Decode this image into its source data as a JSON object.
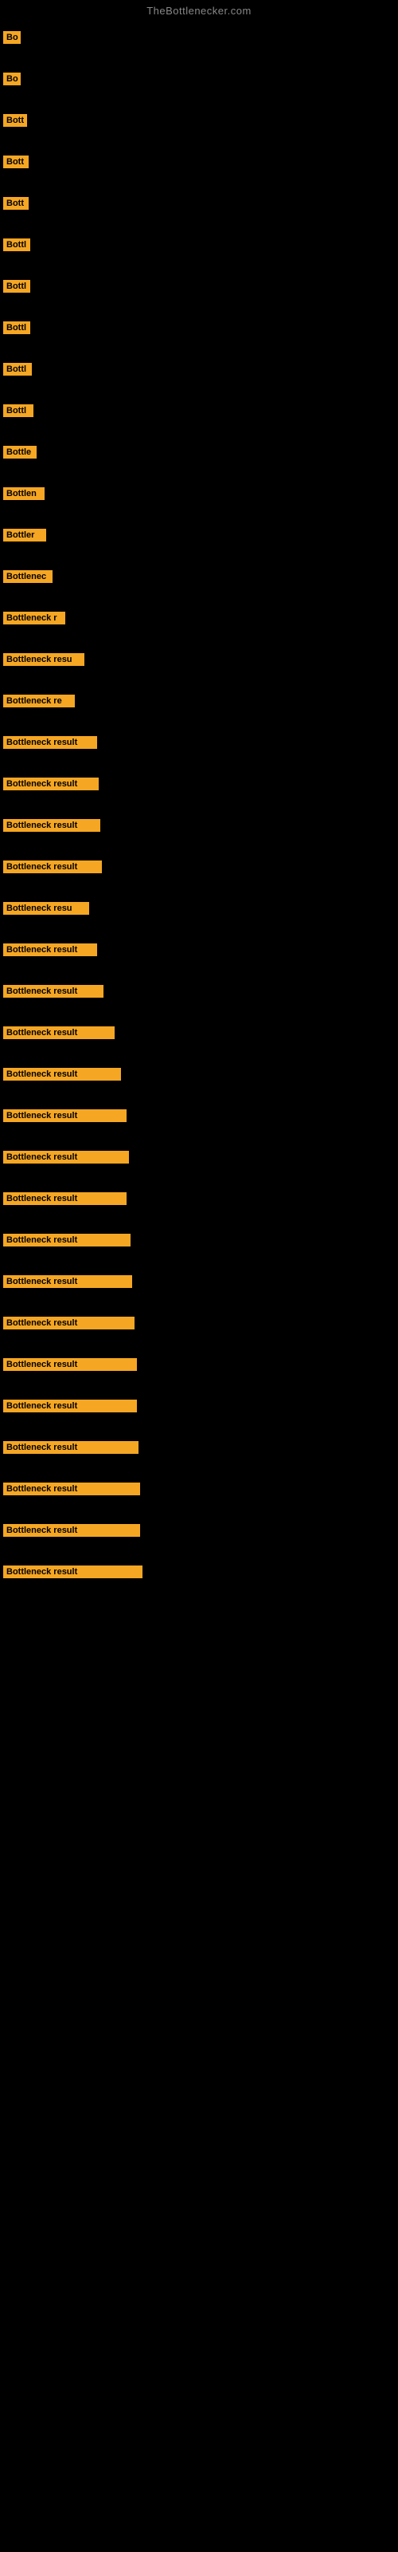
{
  "site": {
    "title": "TheBottlenecker.com"
  },
  "bars": [
    {
      "label": "Bo",
      "width": 22,
      "marginTop": 10
    },
    {
      "label": "Bo",
      "width": 22,
      "marginTop": 28
    },
    {
      "label": "Bott",
      "width": 30,
      "marginTop": 28
    },
    {
      "label": "Bott",
      "width": 32,
      "marginTop": 28
    },
    {
      "label": "Bott",
      "width": 32,
      "marginTop": 28
    },
    {
      "label": "Bottl",
      "width": 34,
      "marginTop": 28
    },
    {
      "label": "Bottl",
      "width": 34,
      "marginTop": 28
    },
    {
      "label": "Bottl",
      "width": 34,
      "marginTop": 28
    },
    {
      "label": "Bottl",
      "width": 36,
      "marginTop": 28
    },
    {
      "label": "Bottl",
      "width": 38,
      "marginTop": 28
    },
    {
      "label": "Bottle",
      "width": 42,
      "marginTop": 28
    },
    {
      "label": "Bottlen",
      "width": 52,
      "marginTop": 28
    },
    {
      "label": "Bottler",
      "width": 54,
      "marginTop": 28
    },
    {
      "label": "Bottlenec",
      "width": 62,
      "marginTop": 28
    },
    {
      "label": "Bottleneck r",
      "width": 78,
      "marginTop": 28
    },
    {
      "label": "Bottleneck resu",
      "width": 102,
      "marginTop": 28
    },
    {
      "label": "Bottleneck re",
      "width": 90,
      "marginTop": 28
    },
    {
      "label": "Bottleneck result",
      "width": 118,
      "marginTop": 28
    },
    {
      "label": "Bottleneck result",
      "width": 120,
      "marginTop": 28
    },
    {
      "label": "Bottleneck result",
      "width": 122,
      "marginTop": 28
    },
    {
      "label": "Bottleneck result",
      "width": 124,
      "marginTop": 28
    },
    {
      "label": "Bottleneck resu",
      "width": 108,
      "marginTop": 28
    },
    {
      "label": "Bottleneck result",
      "width": 118,
      "marginTop": 28
    },
    {
      "label": "Bottleneck result",
      "width": 126,
      "marginTop": 28
    },
    {
      "label": "Bottleneck result",
      "width": 140,
      "marginTop": 28
    },
    {
      "label": "Bottleneck result",
      "width": 148,
      "marginTop": 28
    },
    {
      "label": "Bottleneck result",
      "width": 155,
      "marginTop": 28
    },
    {
      "label": "Bottleneck result",
      "width": 158,
      "marginTop": 28
    },
    {
      "label": "Bottleneck result",
      "width": 155,
      "marginTop": 28
    },
    {
      "label": "Bottleneck result",
      "width": 160,
      "marginTop": 28
    },
    {
      "label": "Bottleneck result",
      "width": 162,
      "marginTop": 28
    },
    {
      "label": "Bottleneck result",
      "width": 165,
      "marginTop": 28
    },
    {
      "label": "Bottleneck result",
      "width": 168,
      "marginTop": 28
    },
    {
      "label": "Bottleneck result",
      "width": 168,
      "marginTop": 28
    },
    {
      "label": "Bottleneck result",
      "width": 170,
      "marginTop": 28
    },
    {
      "label": "Bottleneck result",
      "width": 172,
      "marginTop": 28
    },
    {
      "label": "Bottleneck result",
      "width": 172,
      "marginTop": 28
    },
    {
      "label": "Bottleneck result",
      "width": 175,
      "marginTop": 28
    }
  ]
}
